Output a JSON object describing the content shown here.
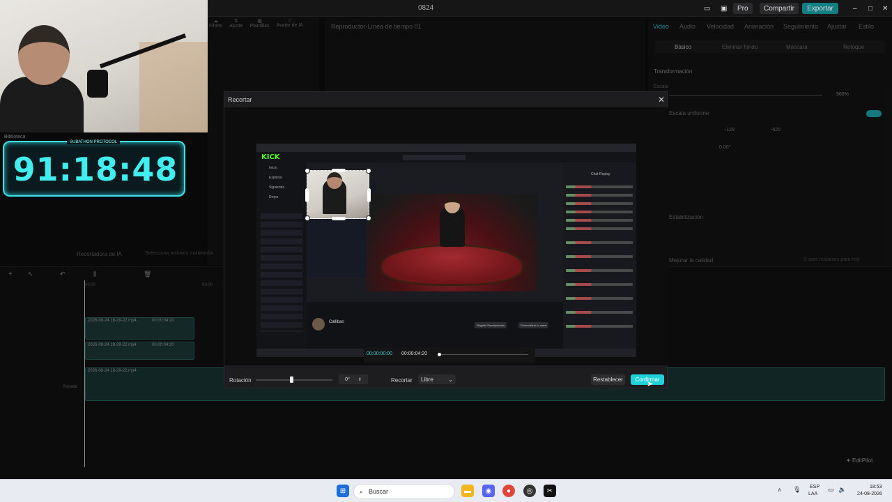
{
  "window": {
    "title": "0824"
  },
  "topbar": {
    "pro_label": "Pro",
    "share_label": "Compartir",
    "export_label": "Exportar"
  },
  "timer": {
    "label": "SUBATHON PROTOCOL",
    "value": "91:18:48"
  },
  "media_panel": {
    "tools": [
      "Filtros",
      "Ajuste",
      "Plantillas",
      "Avatar de IA"
    ],
    "library_label": "Biblioteca",
    "ai_cutter_label": "Recortadora de IA",
    "ai_cutter_hint": "Selecciona archivos multimedia"
  },
  "preview": {
    "title": "Reproductor-Línea de tiempo 01"
  },
  "right_panel": {
    "tabs": [
      "Video",
      "Audio",
      "Velocidad",
      "Animación",
      "Seguimiento",
      "Ajustar",
      "Estilo"
    ],
    "active_tab": "Video",
    "subtabs": [
      "Básico",
      "Eliminar fondo",
      "Máscara",
      "Retoque"
    ],
    "transform_label": "Transformación",
    "scale_label": "Escala",
    "scale_value": "500%",
    "uniform_label": "Escala uniforme",
    "x_value": "-129",
    "y_value": "-620",
    "rotation_value": "0.00°",
    "stabilize_label": "Estabilización",
    "improve_quality_label": "Mejorar la calidad",
    "remaining_label": "3 usos restantes para hoy"
  },
  "timeline": {
    "clips": [
      {
        "name": "2026-08-24 18-29-22.mp4",
        "duration": "00:00:04:20"
      },
      {
        "name": "2026-08-24 18-29-22.mp4",
        "duration": "00:00:04:20"
      },
      {
        "name": "2026-08-24 18-29-22.mp4",
        "duration": "00:00:04:20"
      }
    ],
    "cover_label": "Portada",
    "time_start": "00:00",
    "time_mid": "00:00"
  },
  "modal": {
    "title": "Recortar",
    "time_current": "00:00:00:00",
    "time_total": "00:00:04:20",
    "scrub_progress": 0.0,
    "rotation_label": "Rotación",
    "rotation_value": "0°",
    "crop_label": "Recortar",
    "crop_option": "Libre",
    "reset_label": "Restablecer",
    "confirm_label": "Confirmar"
  },
  "screenshot": {
    "site_logo": "KICK",
    "chat_title": "Chat Replay",
    "streamer_name": "Calliban",
    "sidebar_items": [
      "Inicio",
      "Explorar",
      "Siguiendo",
      "Drops"
    ],
    "btn_subscribe": "Regalar Suscripciones",
    "btn_customize": "Personalizar tu canal"
  },
  "editpilot": {
    "label": "EditPilot"
  },
  "taskbar": {
    "search_placeholder": "Buscar",
    "lang_top": "ESP",
    "lang_bottom": "LAA",
    "clock_time": "18:53",
    "clock_date": "24-08-2026"
  },
  "colors": {
    "accent": "#1fd1d9",
    "timer": "#40eef0",
    "track": "#1f3f3d"
  }
}
